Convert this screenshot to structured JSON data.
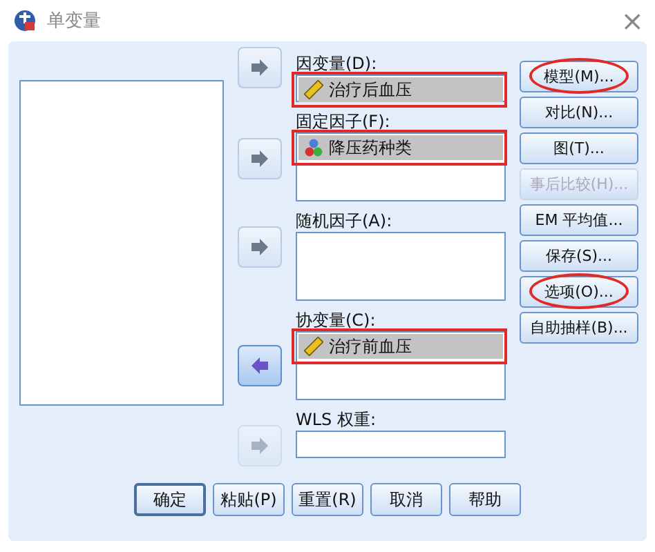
{
  "window": {
    "title": "单变量",
    "close": "×"
  },
  "fields": [
    {
      "label": "因变量(D):",
      "kind": "single",
      "highlighted": true,
      "arrow": {
        "reverse": false,
        "disabled": false
      },
      "items": [
        {
          "name": "治疗后血压",
          "kind": "scale",
          "selected": true
        }
      ]
    },
    {
      "label": "固定因子(F):",
      "kind": "list",
      "highlighted": true,
      "arrow": {
        "reverse": false,
        "disabled": false
      },
      "items": [
        {
          "name": "降压药种类",
          "kind": "nominal",
          "selected": true
        }
      ]
    },
    {
      "label": "随机因子(A):",
      "kind": "list",
      "highlighted": false,
      "arrow": {
        "reverse": false,
        "disabled": false
      }
    },
    {
      "label": "协变量(C):",
      "kind": "list",
      "highlighted": true,
      "arrow": {
        "reverse": true,
        "disabled": false
      },
      "items": [
        {
          "name": "治疗前血压",
          "kind": "scale",
          "selected": true
        }
      ]
    },
    {
      "label": "WLS 权重:",
      "kind": "single",
      "highlighted": false,
      "arrow": {
        "reverse": false,
        "disabled": true
      }
    }
  ],
  "side_buttons": [
    {
      "label": "模型(M)...",
      "disabled": false,
      "circled": true
    },
    {
      "label": "对比(N)...",
      "disabled": false,
      "circled": false
    },
    {
      "label": "图(T)...",
      "disabled": false,
      "circled": false
    },
    {
      "label": "事后比较(H)...",
      "disabled": true,
      "circled": false
    },
    {
      "label": "EM 平均值...",
      "disabled": false,
      "circled": false
    },
    {
      "label": "保存(S)...",
      "disabled": false,
      "circled": false
    },
    {
      "label": "选项(O)...",
      "disabled": false,
      "circled": true
    },
    {
      "label": "自助抽样(B)...",
      "disabled": false,
      "circled": false
    }
  ],
  "footer_buttons": [
    {
      "label": "确定",
      "default": true
    },
    {
      "label": "粘贴(P)",
      "default": false
    },
    {
      "label": "重置(R)",
      "default": false
    },
    {
      "label": "取消",
      "default": false
    },
    {
      "label": "帮助",
      "default": false
    }
  ]
}
